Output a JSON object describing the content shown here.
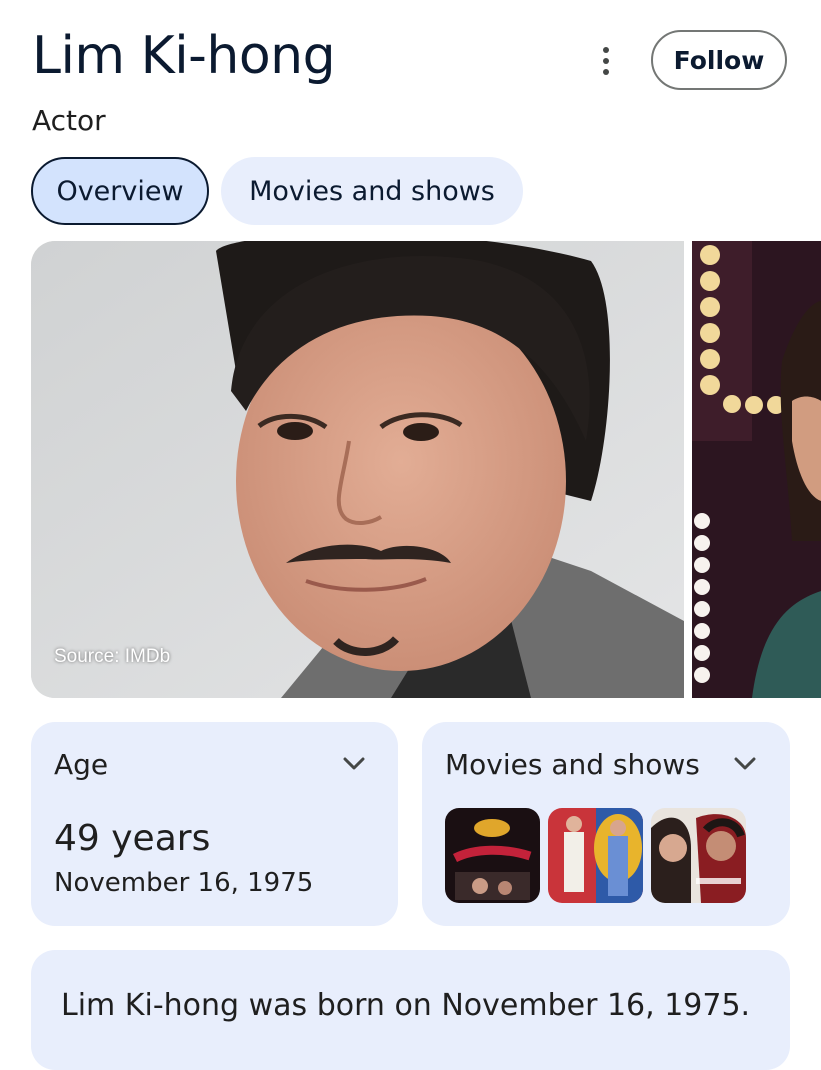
{
  "header": {
    "title": "Lim Ki-hong",
    "subtitle": "Actor",
    "more_icon": "more-vert-icon",
    "follow_label": "Follow"
  },
  "tabs": [
    {
      "label": "Overview",
      "active": true
    },
    {
      "label": "Movies and shows",
      "active": false
    }
  ],
  "images": {
    "source_label": "Source: IMDb"
  },
  "age_card": {
    "title": "Age",
    "value": "49 years",
    "birth_date": "November 16, 1975",
    "icon": "chevron-down-icon"
  },
  "movies_card": {
    "title": "Movies and shows",
    "icon": "chevron-down-icon",
    "thumbnail_count": 3
  },
  "bio": {
    "text": "Lim Ki-hong was born on November 16, 1975."
  },
  "colors": {
    "accent": "#d3e3fd",
    "card_bg": "#e8eefc",
    "title_text": "#0b1a30"
  }
}
